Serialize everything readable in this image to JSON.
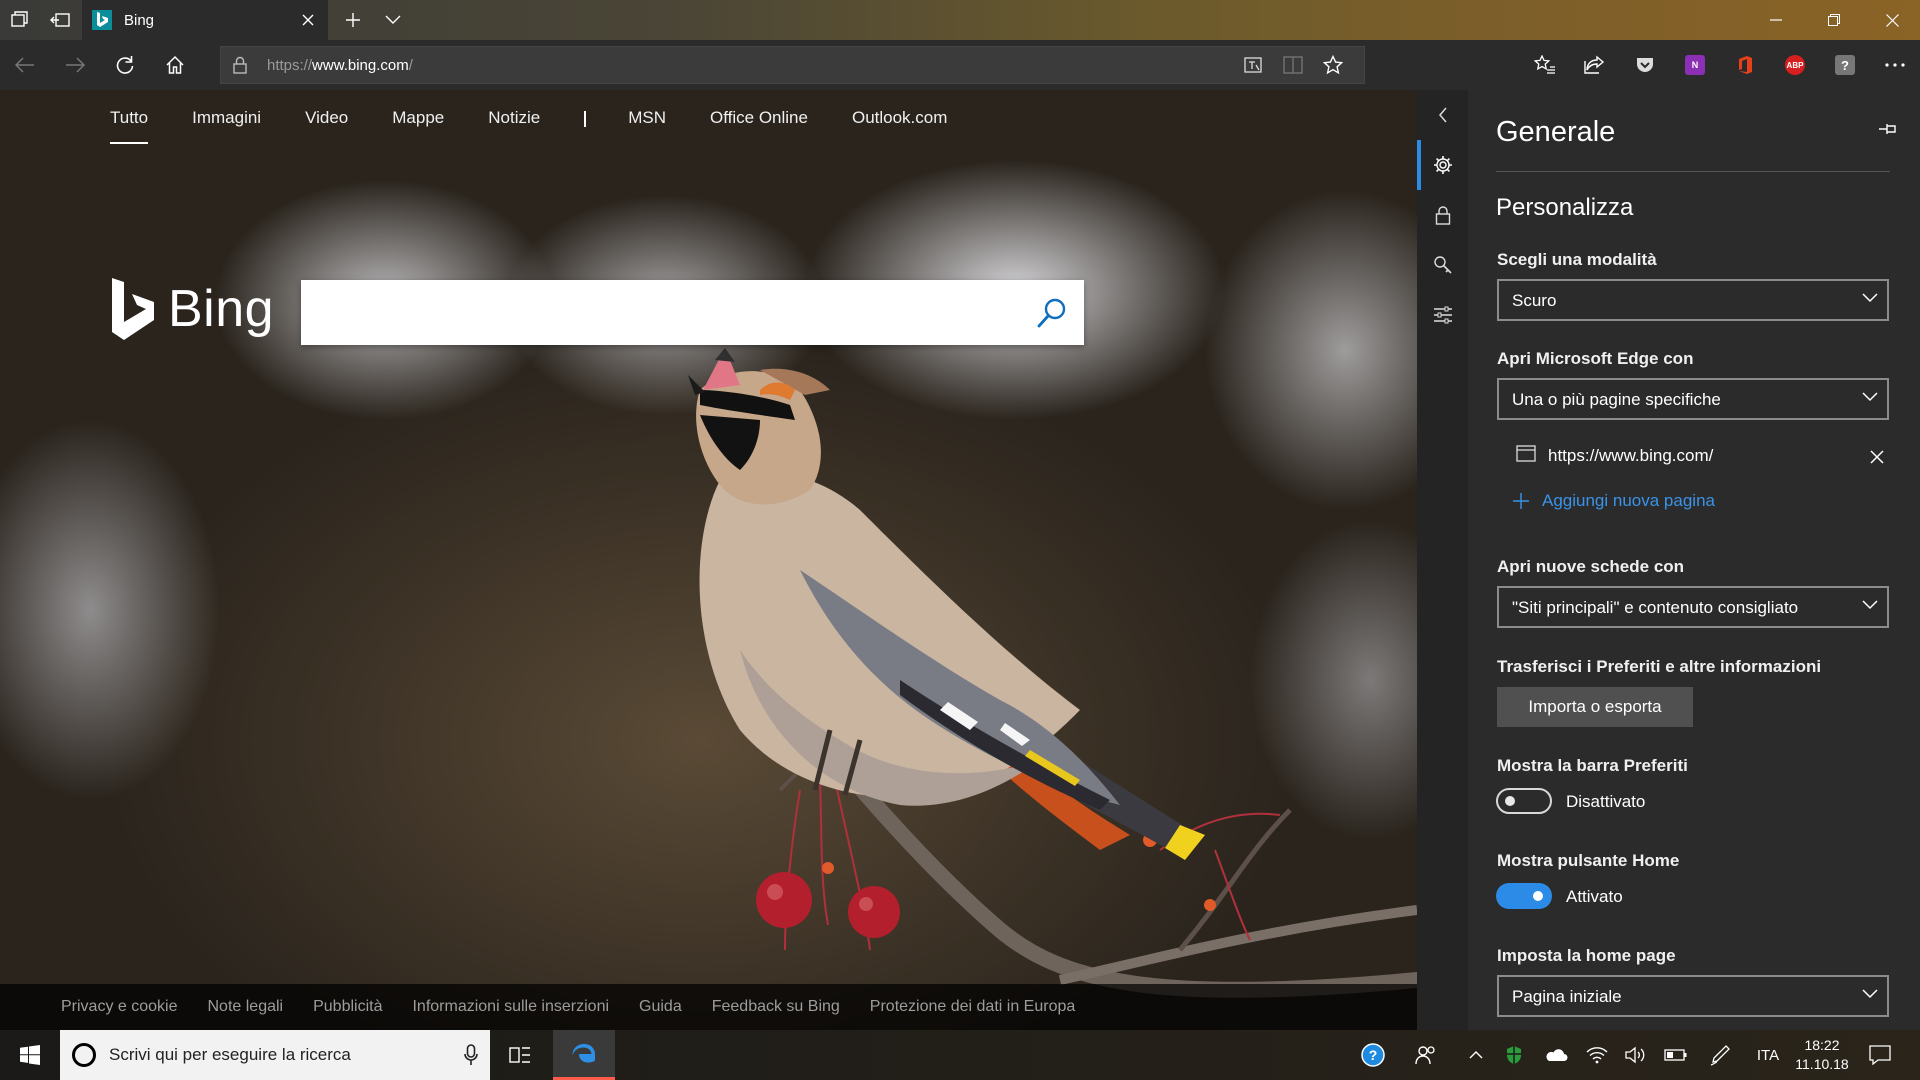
{
  "browser": {
    "tab": {
      "title": "Bing"
    },
    "url": {
      "prefix": "https://",
      "host": "www.bing.com",
      "suffix": "/"
    }
  },
  "bing": {
    "nav": [
      "Tutto",
      "Immagini",
      "Video",
      "Mappe",
      "Notizie",
      "MSN",
      "Office Online",
      "Outlook.com"
    ],
    "logo_text": "Bing",
    "search_placeholder": "",
    "footer": [
      "Privacy e cookie",
      "Note legali",
      "Pubblicità",
      "Informazioni sulle inserzioni",
      "Guida",
      "Feedback su Bing",
      "Protezione dei dati in Europa"
    ]
  },
  "settings": {
    "title": "Generale",
    "section": "Personalizza",
    "mode": {
      "label": "Scegli una modalità",
      "value": "Scuro"
    },
    "open_with": {
      "label": "Apri Microsoft Edge con",
      "value": "Una o più pagine specifiche"
    },
    "start_page": {
      "url": "https://www.bing.com/"
    },
    "add_page": "Aggiungi nuova pagina",
    "new_tabs": {
      "label": "Apri nuove schede con",
      "value": "\"Siti principali\" e contenuto consigliato"
    },
    "transfer": {
      "label": "Trasferisci i Preferiti e altre informazioni",
      "button": "Importa o esporta"
    },
    "fav_bar": {
      "label": "Mostra la barra Preferiti",
      "state": "Disattivato"
    },
    "home_button": {
      "label": "Mostra pulsante Home",
      "state": "Attivato"
    },
    "home_page": {
      "label": "Imposta la home page",
      "value": "Pagina iniziale"
    }
  },
  "taskbar": {
    "search_placeholder": "Scrivi qui per eseguire la ricerca",
    "language": "ITA",
    "time": "18:22",
    "date": "11.10.18"
  },
  "colors": {
    "accent": "#2b8be6",
    "link": "#3a93e8",
    "bing_teal": "#0b8e9a",
    "edge_blue": "#1e7fd8"
  }
}
